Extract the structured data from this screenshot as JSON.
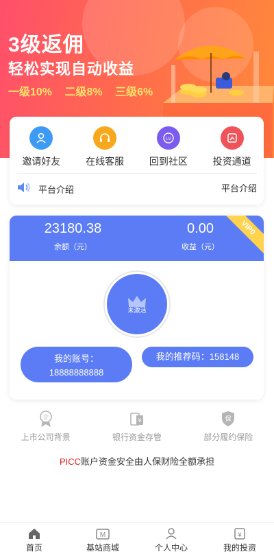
{
  "banner": {
    "title": "3级返佣",
    "subtitle": "轻松实现自动收益",
    "rates": [
      "一级10%",
      "二级8%",
      "三级6%"
    ]
  },
  "actions": [
    {
      "label": "邀请好友",
      "icon": "invite-user-icon",
      "color": "#3d9bf5"
    },
    {
      "label": "在线客服",
      "icon": "headset-icon",
      "color": "#f7a81c"
    },
    {
      "label": "回到社区",
      "icon": "lv-badge-icon",
      "color": "#7a5cf0"
    },
    {
      "label": "投资通道",
      "icon": "investment-icon",
      "color": "#f0525a"
    }
  ],
  "notice": {
    "text": "平台介绍",
    "link": "平台介绍"
  },
  "account": {
    "balance": "23180.38",
    "balance_label": "余额（元）",
    "income": "0.00",
    "income_label": "收益（元）",
    "vip": "VIP0",
    "status": "未激活",
    "account_label": "我的账号：",
    "account_value": "18888888888",
    "referral": "我的推荐码：158148"
  },
  "features": [
    {
      "label": "上市公司背景",
      "icon": "certified-badge-icon"
    },
    {
      "label": "银行资金存管",
      "icon": "bank-deposit-icon"
    },
    {
      "label": "部分履约保险",
      "icon": "insurance-shield-icon"
    }
  ],
  "guarantee": {
    "brand": "PICC",
    "text": "账户资金安全由人保财险全额承担"
  },
  "tabs": [
    {
      "label": "首页",
      "icon": "home-icon"
    },
    {
      "label": "基站商城",
      "icon": "mall-icon"
    },
    {
      "label": "个人中心",
      "icon": "user-icon"
    },
    {
      "label": "我的投资",
      "icon": "investment-wallet-icon"
    }
  ],
  "colors": {
    "accent": "#5b7cf4",
    "banner_from": "#ff4f6b",
    "banner_to": "#ff8a3a",
    "vip": "#ffd34d"
  }
}
